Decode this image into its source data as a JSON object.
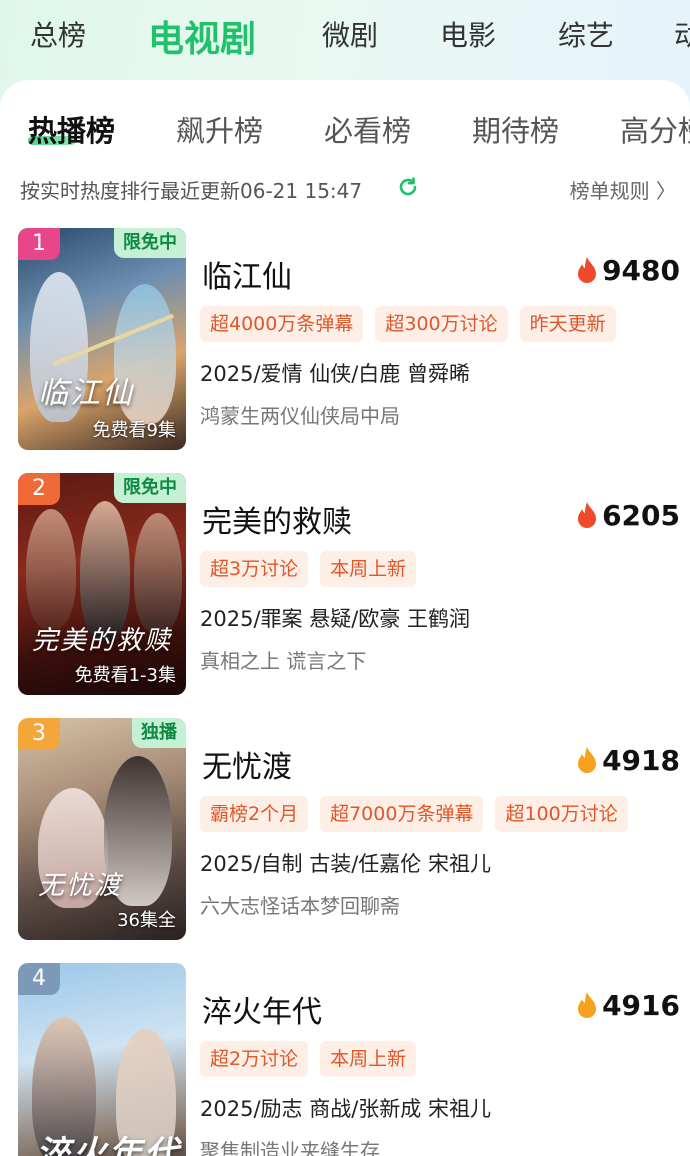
{
  "top_tabs": [
    {
      "label": "总榜"
    },
    {
      "label": "电视剧"
    },
    {
      "label": "微剧"
    },
    {
      "label": "电影"
    },
    {
      "label": "综艺"
    },
    {
      "label": "动"
    }
  ],
  "sub_tabs": [
    {
      "label": "热播榜"
    },
    {
      "label": "飙升榜"
    },
    {
      "label": "必看榜"
    },
    {
      "label": "期待榜"
    },
    {
      "label": "高分榜"
    }
  ],
  "update_text": "按实时热度排行最近更新06-21 15:47",
  "rules_label": "榜单规则 〉",
  "colors": {
    "accent_green": "#1fc26b",
    "tag_text": "#e0572a",
    "tag_bg": "#fdeee6",
    "free_tag_bg": "#c6f0d3",
    "rank1": "#e8458b",
    "rank2": "#ef6a37",
    "rank3": "#f3a73a",
    "rank4": "#7c9ab8",
    "flame_hot": "#f04a2c",
    "flame_warm": "#f6a21e"
  },
  "shows": [
    {
      "rank": "1",
      "poster_tag": "限免中",
      "poster_title": "临江仙",
      "episode_note": "免费看9集",
      "title": "临江仙",
      "heat": "9480",
      "tags": [
        "超4000万条弹幕",
        "超300万讨论",
        "昨天更新"
      ],
      "meta": "2025/爱情 仙侠/白鹿 曾舜晞",
      "slogan": "鸿蒙生两仪仙侠局中局"
    },
    {
      "rank": "2",
      "poster_tag": "限免中",
      "poster_title": "完美的救赎",
      "episode_note": "免费看1-3集",
      "title": "完美的救赎",
      "heat": "6205",
      "tags": [
        "超3万讨论",
        "本周上新"
      ],
      "meta": "2025/罪案 悬疑/欧豪 王鹤润",
      "slogan": "真相之上 谎言之下"
    },
    {
      "rank": "3",
      "poster_tag": "独播",
      "poster_title": "无忧渡",
      "episode_note": "36集全",
      "title": "无忧渡",
      "heat": "4918",
      "tags": [
        "霸榜2个月",
        "超7000万条弹幕",
        "超100万讨论"
      ],
      "meta": "2025/自制 古装/任嘉伦 宋祖儿",
      "slogan": "六大志怪话本梦回聊斋"
    },
    {
      "rank": "4",
      "poster_title": "淬火年代",
      "title": "淬火年代",
      "heat": "4916",
      "tags": [
        "超2万讨论",
        "本周上新"
      ],
      "meta": "2025/励志 商战/张新成 宋祖儿",
      "slogan": "聚焦制造业夹缝生存"
    }
  ]
}
